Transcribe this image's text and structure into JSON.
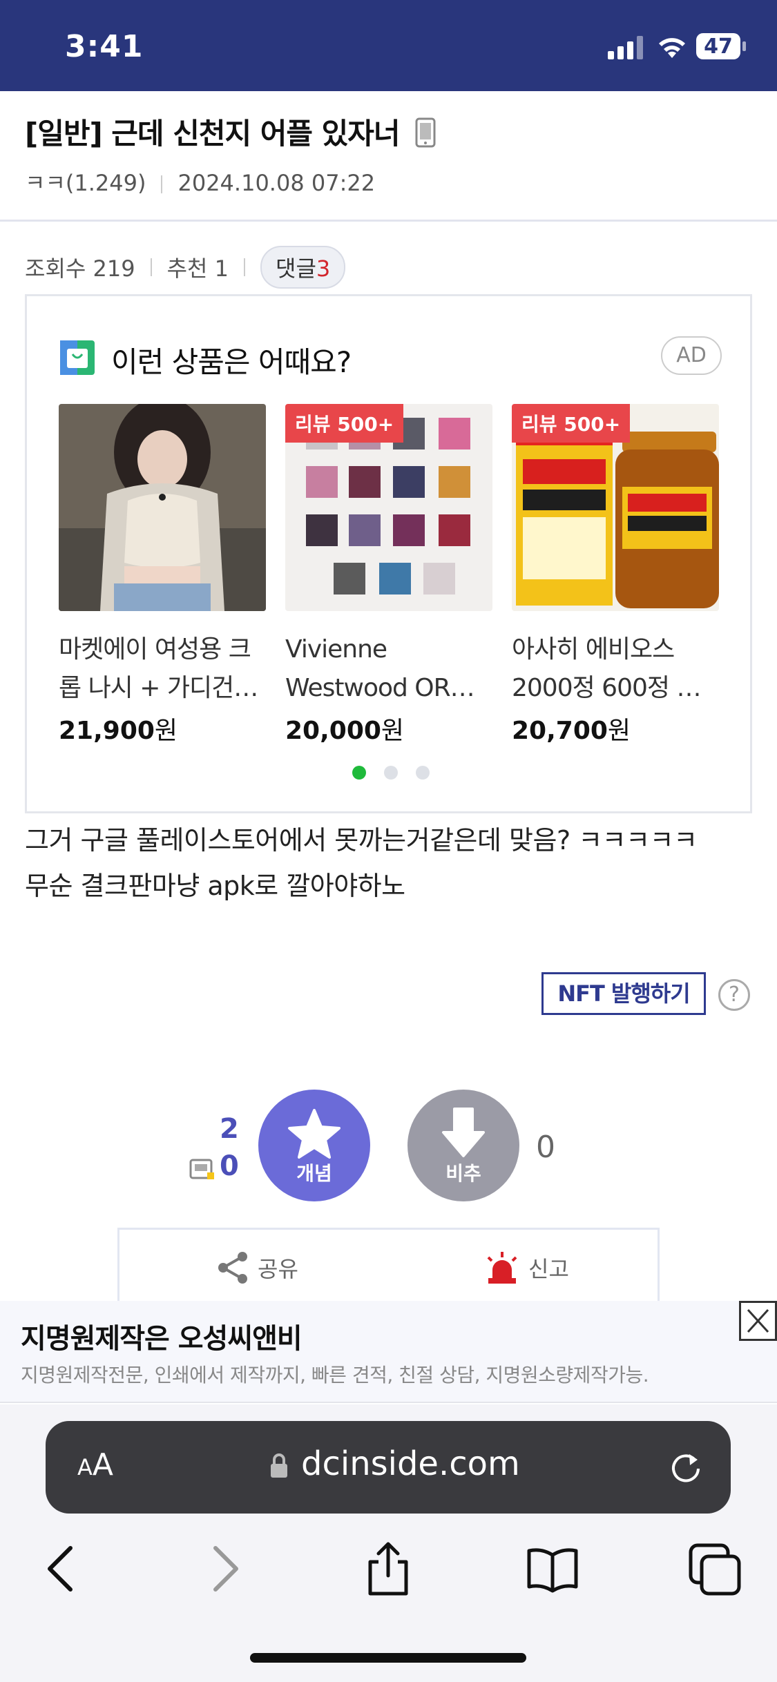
{
  "status_bar": {
    "time": "3:41",
    "battery": "47"
  },
  "post": {
    "title": "[일반] 근데 신천지 어플 있자너",
    "author": "ㅋㅋ(1.249)",
    "date": "2024.10.08 07:22",
    "views_label": "조회수 219",
    "recommend_label": "추천 1",
    "comment_label": "댓글",
    "comment_count": "3",
    "body_line1": "그거 구글 풀레이스토어에서 못까는거같은데 맞음? ㅋㅋㅋㅋㅋ",
    "body_line2": "무순 결크판마냥 apk로 깔아야하노"
  },
  "ad": {
    "heading": "이런 상품은 어때요?",
    "badge": "AD",
    "products": [
      {
        "tag": "",
        "name_line1": "마켓에이 여성용 크",
        "name_line2": "롭 나시 + 가디건…",
        "price": "21,900",
        "currency": "원"
      },
      {
        "tag": "리뷰 500+",
        "name_line1": "Vivienne",
        "name_line2": "Westwood OR…",
        "price": "20,000",
        "currency": "원"
      },
      {
        "tag": "리뷰 500+",
        "name_line1": "아사히 에비오스",
        "name_line2": "2000정 600정 …",
        "price": "20,700",
        "currency": "원"
      }
    ]
  },
  "nft_button": "NFT 발행하기",
  "help": "?",
  "vote": {
    "up_count": "2",
    "fix_count": "0",
    "up_label": "개념",
    "down_label": "비추",
    "down_count": "0"
  },
  "actions": {
    "share": "공유",
    "report": "신고"
  },
  "banner": {
    "title": "지명원제작은 오성씨앤비",
    "desc": "지명원제작전문, 인쇄에서 제작까지, 빠른 견적, 친절 상담, 지명원소량제작가능."
  },
  "safari": {
    "aa_small": "A",
    "aa_big": "A",
    "url": "dcinside.com"
  },
  "colors": {
    "header": "#29367c",
    "accent": "#6b6bd8",
    "nft": "#2e3a8f",
    "tag": "#e8464a"
  }
}
